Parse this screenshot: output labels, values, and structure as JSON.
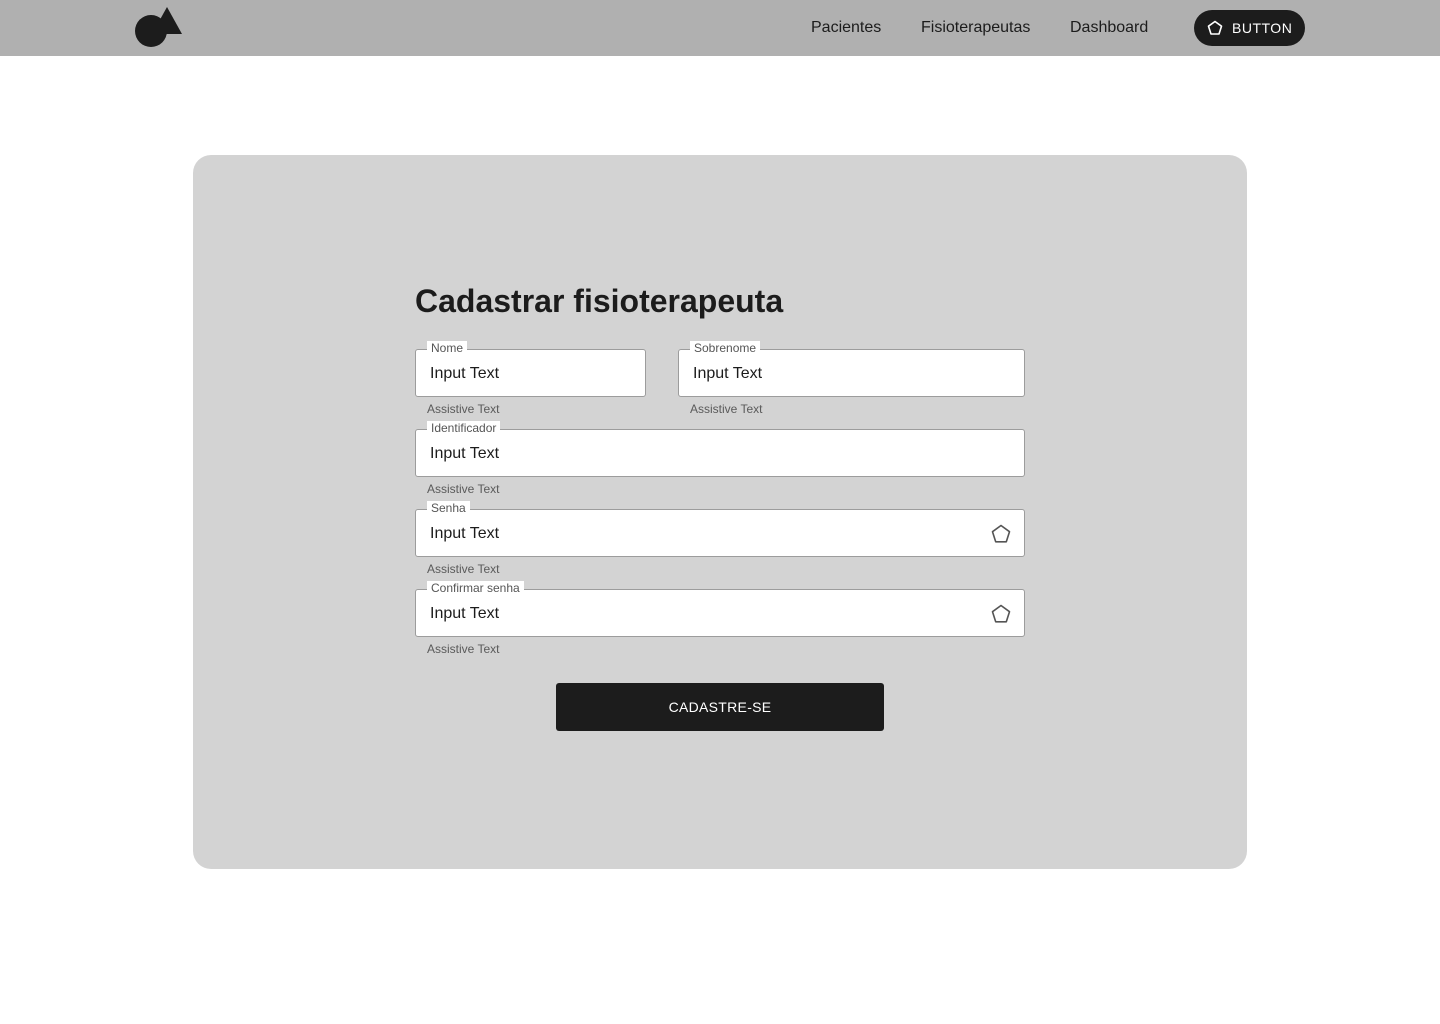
{
  "header": {
    "logo_icon": "shapes-logo-icon",
    "nav": {
      "pacientes": "Pacientes",
      "fisioterapeutas": "Fisioterapeutas",
      "dashboard": "Dashboard"
    },
    "button": {
      "label": "BUTTON",
      "icon": "pentagon-icon"
    }
  },
  "form": {
    "title": "Cadastrar fisioterapeuta",
    "fields": {
      "nome": {
        "label": "Nome",
        "placeholder": "Input Text",
        "assistive": "Assistive Text"
      },
      "sobrenome": {
        "label": "Sobrenome",
        "placeholder": "Input Text",
        "assistive": "Assistive Text"
      },
      "identificador": {
        "label": "Identificador",
        "placeholder": "Input Text",
        "assistive": "Assistive Text"
      },
      "senha": {
        "label": "Senha",
        "placeholder": "Input Text",
        "assistive": "Assistive Text",
        "icon": "pentagon-icon"
      },
      "confirmar_senha": {
        "label": "Confirmar senha",
        "placeholder": "Input Text",
        "assistive": "Assistive Text",
        "icon": "pentagon-icon"
      }
    },
    "submit_label": "CADASTRE-SE"
  },
  "colors": {
    "header_bg": "#b0b0b0",
    "card_bg": "#d3d3d3",
    "dark": "#1c1c1c",
    "field_border": "#9c9c9c"
  }
}
